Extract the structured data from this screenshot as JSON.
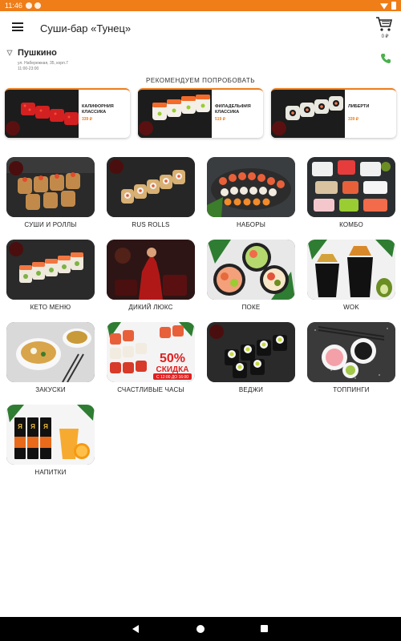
{
  "status_bar": {
    "time": "11:46"
  },
  "app": {
    "title": "Суши-бар «Тунец»"
  },
  "cart": {
    "total": "0 ₽"
  },
  "location": {
    "city": "Пушкино",
    "address": "ул. Набережная, 35, корп.7",
    "hours": "11:00-23:00"
  },
  "recommend": {
    "heading": "РЕКОМЕНДУЕМ ПОПРОБОВАТЬ",
    "items": [
      {
        "name": "КАЛИФОРНИЯ КЛАССИКА",
        "price": "339 ₽"
      },
      {
        "name": "ФИЛАДЕЛЬФИЯ КЛАССИКА",
        "price": "519 ₽"
      },
      {
        "name": "ЛИБЕРТИ",
        "price": "339 ₽"
      }
    ]
  },
  "categories": [
    {
      "label": "СУШИ И РОЛЛЫ"
    },
    {
      "label": "RUS ROLLS"
    },
    {
      "label": "НАБОРЫ"
    },
    {
      "label": "КОМБО"
    },
    {
      "label": "КЕТО МЕНЮ"
    },
    {
      "label": "ДИКИЙ ЛЮКС"
    },
    {
      "label": "ПОКЕ"
    },
    {
      "label": "WOK"
    },
    {
      "label": "ЗАКУСКИ"
    },
    {
      "label": "СЧАСТЛИВЫЕ ЧАСЫ"
    },
    {
      "label": "ВЕДЖИ"
    },
    {
      "label": "ТОППИНГИ"
    },
    {
      "label": "НАПИТКИ"
    }
  ],
  "promo": {
    "percent": "50%",
    "word": "СКИДКА",
    "time": "С 12:00 ДО 16:00"
  },
  "drink_letter": "Я",
  "colors": {
    "accent": "#ef7d18",
    "phone": "#4caf50",
    "navbar": "#000000"
  },
  "icons": [
    "menu-icon",
    "cart-icon",
    "location-icon",
    "phone-icon",
    "back-icon",
    "home-icon",
    "recents-icon"
  ]
}
